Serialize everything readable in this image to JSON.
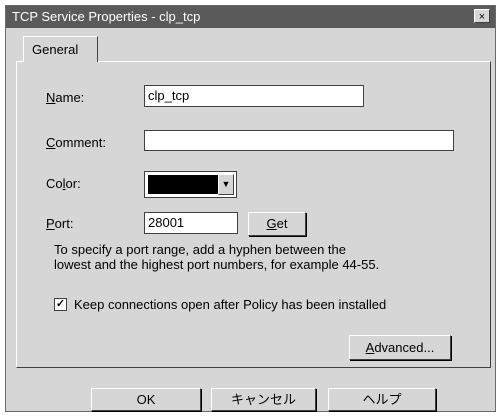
{
  "window": {
    "title": "TCP Service Properties - clp_tcp",
    "close_glyph": "×"
  },
  "tabs": [
    {
      "label": "General"
    }
  ],
  "form": {
    "name_label_key": "N",
    "name_label_rest": "ame:",
    "name_value": "clp_tcp",
    "comment_label_key": "C",
    "comment_label_rest": "omment:",
    "comment_value": "",
    "color_label_pre": "Co",
    "color_label_key": "l",
    "color_label_rest": "or:",
    "color_value": "#000000",
    "port_label_key": "P",
    "port_label_rest": "ort:",
    "port_value": "28001",
    "get_label_key": "G",
    "get_label_rest": "et",
    "port_help_line1": "To specify a port range, add a hyphen between the",
    "port_help_line2": "lowest and the highest port numbers, for example 44-55.",
    "keep_checked": true,
    "keep_label": "Keep connections open after Policy has been installed",
    "advanced_label_key": "A",
    "advanced_label_rest": "dvanced..."
  },
  "footer": {
    "ok_label": "OK",
    "cancel_label": "キャンセル",
    "help_label": "ヘルプ"
  },
  "icons": {
    "dropdown": "chevron-down-icon",
    "checkbox": "check-icon"
  }
}
